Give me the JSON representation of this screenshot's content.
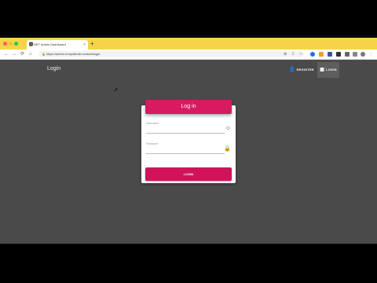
{
  "browser": {
    "tab_title": "NET Admin Dashboard",
    "tab_close": "×",
    "new_tab": "+",
    "favicon": "🅰",
    "url": "https://admin-templatedev.io/auth/login",
    "nav": {
      "back": "←",
      "forward": "→",
      "reload": "⟳",
      "home": "⌂",
      "lock": "🔒"
    },
    "colors": {
      "tabstrip": "#f5d44a"
    }
  },
  "app": {
    "brand": "Login",
    "nav": {
      "register_label": "Register",
      "register_icon": "👤",
      "login_label": "Login",
      "login_icon": "▦"
    }
  },
  "login_card": {
    "header": "Log in",
    "username_label": "Username",
    "password_label": "Password",
    "username_icon": "☺",
    "password_icon": "🔒",
    "submit_label": "LOGIN"
  },
  "faint_text": "",
  "colors": {
    "accent": "#d81b60",
    "background": "#4a4a4a"
  }
}
